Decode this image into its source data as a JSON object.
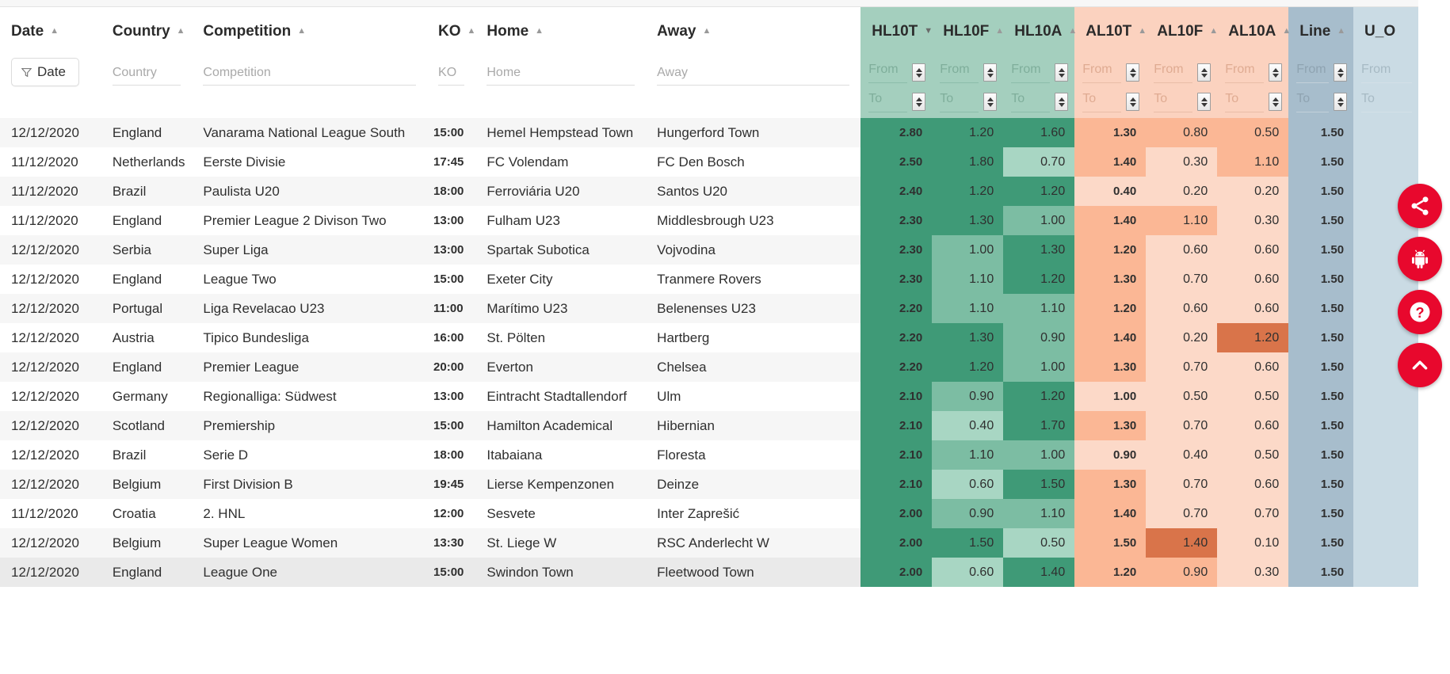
{
  "table": {
    "columns": [
      {
        "key": "date",
        "label": "Date",
        "sort": "asc",
        "group": "plain"
      },
      {
        "key": "country",
        "label": "Country",
        "sort": "asc",
        "group": "plain"
      },
      {
        "key": "comp",
        "label": "Competition",
        "sort": "asc",
        "group": "plain"
      },
      {
        "key": "ko",
        "label": "KO",
        "sort": "asc",
        "group": "plain"
      },
      {
        "key": "home",
        "label": "Home",
        "sort": "asc",
        "group": "plain"
      },
      {
        "key": "away",
        "label": "Away",
        "sort": "asc",
        "group": "plain"
      },
      {
        "key": "hl10t",
        "label": "HL10T",
        "sort": "desc",
        "group": "hl"
      },
      {
        "key": "hl10f",
        "label": "HL10F",
        "sort": "asc",
        "group": "hl"
      },
      {
        "key": "hl10a",
        "label": "HL10A",
        "sort": "asc",
        "group": "hl"
      },
      {
        "key": "al10t",
        "label": "AL10T",
        "sort": "asc",
        "group": "al"
      },
      {
        "key": "al10f",
        "label": "AL10F",
        "sort": "asc",
        "group": "al"
      },
      {
        "key": "al10a",
        "label": "AL10A",
        "sort": "asc",
        "group": "al"
      },
      {
        "key": "line",
        "label": "Line",
        "sort": "asc",
        "group": "line"
      },
      {
        "key": "uo",
        "label": "U_O",
        "sort": "asc",
        "group": "uo"
      }
    ],
    "filters": {
      "date_chip": "Date",
      "country": "Country",
      "competition": "Competition",
      "ko": "KO",
      "home": "Home",
      "away": "Away",
      "from": "From",
      "to": "To"
    },
    "rows": [
      {
        "date": "12/12/2020",
        "country": "England",
        "comp": "Vanarama National League South",
        "ko": "15:00",
        "home": "Hemel Hempstead Town",
        "away": "Hungerford Town",
        "hl10t": "2.80",
        "hl10f": "1.20",
        "hl10a": "1.60",
        "al10t": "1.30",
        "al10f": "0.80",
        "al10a": "0.50",
        "line": "1.50",
        "uo": "",
        "sh_t": 3,
        "sh_f": 3,
        "sh_a": 3,
        "sa_t": 3,
        "sa_f": 2,
        "sa_a": 2
      },
      {
        "date": "11/12/2020",
        "country": "Netherlands",
        "comp": "Eerste Divisie",
        "ko": "17:45",
        "home": "FC Volendam",
        "away": "FC Den Bosch",
        "hl10t": "2.50",
        "hl10f": "1.80",
        "hl10a": "0.70",
        "al10t": "1.40",
        "al10f": "0.30",
        "al10a": "1.10",
        "line": "1.50",
        "uo": "",
        "sh_t": 3,
        "sh_f": 3,
        "sh_a": 1,
        "sa_t": 3,
        "sa_f": 1,
        "sa_a": 3
      },
      {
        "date": "11/12/2020",
        "country": "Brazil",
        "comp": "Paulista U20",
        "ko": "18:00",
        "home": "Ferroviária U20",
        "away": "Santos U20",
        "hl10t": "2.40",
        "hl10f": "1.20",
        "hl10a": "1.20",
        "al10t": "0.40",
        "al10f": "0.20",
        "al10a": "0.20",
        "line": "1.50",
        "uo": "",
        "sh_t": 3,
        "sh_f": 3,
        "sh_a": 3,
        "sa_t": 1,
        "sa_f": 1,
        "sa_a": 1
      },
      {
        "date": "11/12/2020",
        "country": "England",
        "comp": "Premier League 2 Divison Two",
        "ko": "13:00",
        "home": "Fulham U23",
        "away": "Middlesbrough U23",
        "hl10t": "2.30",
        "hl10f": "1.30",
        "hl10a": "1.00",
        "al10t": "1.40",
        "al10f": "1.10",
        "al10a": "0.30",
        "line": "1.50",
        "uo": "",
        "sh_t": 3,
        "sh_f": 3,
        "sh_a": 2,
        "sa_t": 3,
        "sa_f": 3,
        "sa_a": 1
      },
      {
        "date": "12/12/2020",
        "country": "Serbia",
        "comp": "Super Liga",
        "ko": "13:00",
        "home": "Spartak Subotica",
        "away": "Vojvodina",
        "hl10t": "2.30",
        "hl10f": "1.00",
        "hl10a": "1.30",
        "al10t": "1.20",
        "al10f": "0.60",
        "al10a": "0.60",
        "line": "1.50",
        "uo": "",
        "sh_t": 3,
        "sh_f": 2,
        "sh_a": 3,
        "sa_t": 3,
        "sa_f": 1,
        "sa_a": 1
      },
      {
        "date": "12/12/2020",
        "country": "England",
        "comp": "League Two",
        "ko": "15:00",
        "home": "Exeter City",
        "away": "Tranmere Rovers",
        "hl10t": "2.30",
        "hl10f": "1.10",
        "hl10a": "1.20",
        "al10t": "1.30",
        "al10f": "0.70",
        "al10a": "0.60",
        "line": "1.50",
        "uo": "",
        "sh_t": 3,
        "sh_f": 2,
        "sh_a": 3,
        "sa_t": 3,
        "sa_f": 1,
        "sa_a": 1
      },
      {
        "date": "12/12/2020",
        "country": "Portugal",
        "comp": "Liga Revelacao U23",
        "ko": "11:00",
        "home": "Marítimo U23",
        "away": "Belenenses U23",
        "hl10t": "2.20",
        "hl10f": "1.10",
        "hl10a": "1.10",
        "al10t": "1.20",
        "al10f": "0.60",
        "al10a": "0.60",
        "line": "1.50",
        "uo": "",
        "sh_t": 3,
        "sh_f": 2,
        "sh_a": 2,
        "sa_t": 3,
        "sa_f": 1,
        "sa_a": 1
      },
      {
        "date": "12/12/2020",
        "country": "Austria",
        "comp": "Tipico Bundesliga",
        "ko": "16:00",
        "home": "St. Pölten",
        "away": "Hartberg",
        "hl10t": "2.20",
        "hl10f": "1.30",
        "hl10a": "0.90",
        "al10t": "1.40",
        "al10f": "0.20",
        "al10a": "1.20",
        "line": "1.50",
        "uo": "",
        "sh_t": 3,
        "sh_f": 3,
        "sh_a": 2,
        "sa_t": 3,
        "sa_f": 1,
        "sa_a": 4
      },
      {
        "date": "12/12/2020",
        "country": "England",
        "comp": "Premier League",
        "ko": "20:00",
        "home": "Everton",
        "away": "Chelsea",
        "hl10t": "2.20",
        "hl10f": "1.20",
        "hl10a": "1.00",
        "al10t": "1.30",
        "al10f": "0.70",
        "al10a": "0.60",
        "line": "1.50",
        "uo": "",
        "sh_t": 3,
        "sh_f": 3,
        "sh_a": 2,
        "sa_t": 3,
        "sa_f": 1,
        "sa_a": 1
      },
      {
        "date": "12/12/2020",
        "country": "Germany",
        "comp": "Regionalliga: Südwest",
        "ko": "13:00",
        "home": "Eintracht Stadtallendorf",
        "away": "Ulm",
        "hl10t": "2.10",
        "hl10f": "0.90",
        "hl10a": "1.20",
        "al10t": "1.00",
        "al10f": "0.50",
        "al10a": "0.50",
        "line": "1.50",
        "uo": "",
        "sh_t": 3,
        "sh_f": 2,
        "sh_a": 3,
        "sa_t": 1,
        "sa_f": 1,
        "sa_a": 1
      },
      {
        "date": "12/12/2020",
        "country": "Scotland",
        "comp": "Premiership",
        "ko": "15:00",
        "home": "Hamilton Academical",
        "away": "Hibernian",
        "hl10t": "2.10",
        "hl10f": "0.40",
        "hl10a": "1.70",
        "al10t": "1.30",
        "al10f": "0.70",
        "al10a": "0.60",
        "line": "1.50",
        "uo": "",
        "sh_t": 3,
        "sh_f": 1,
        "sh_a": 3,
        "sa_t": 3,
        "sa_f": 1,
        "sa_a": 1
      },
      {
        "date": "12/12/2020",
        "country": "Brazil",
        "comp": "Serie D",
        "ko": "18:00",
        "home": "Itabaiana",
        "away": "Floresta",
        "hl10t": "2.10",
        "hl10f": "1.10",
        "hl10a": "1.00",
        "al10t": "0.90",
        "al10f": "0.40",
        "al10a": "0.50",
        "line": "1.50",
        "uo": "",
        "sh_t": 3,
        "sh_f": 2,
        "sh_a": 2,
        "sa_t": 1,
        "sa_f": 1,
        "sa_a": 1
      },
      {
        "date": "12/12/2020",
        "country": "Belgium",
        "comp": "First Division B",
        "ko": "19:45",
        "home": "Lierse Kempenzonen",
        "away": "Deinze",
        "hl10t": "2.10",
        "hl10f": "0.60",
        "hl10a": "1.50",
        "al10t": "1.30",
        "al10f": "0.70",
        "al10a": "0.60",
        "line": "1.50",
        "uo": "",
        "sh_t": 3,
        "sh_f": 1,
        "sh_a": 3,
        "sa_t": 3,
        "sa_f": 1,
        "sa_a": 1
      },
      {
        "date": "11/12/2020",
        "country": "Croatia",
        "comp": "2. HNL",
        "ko": "12:00",
        "home": "Sesvete",
        "away": "Inter Zaprešić",
        "hl10t": "2.00",
        "hl10f": "0.90",
        "hl10a": "1.10",
        "al10t": "1.40",
        "al10f": "0.70",
        "al10a": "0.70",
        "line": "1.50",
        "uo": "",
        "sh_t": 3,
        "sh_f": 2,
        "sh_a": 2,
        "sa_t": 3,
        "sa_f": 1,
        "sa_a": 1
      },
      {
        "date": "12/12/2020",
        "country": "Belgium",
        "comp": "Super League Women",
        "ko": "13:30",
        "home": "St. Liege W",
        "away": "RSC Anderlecht W",
        "hl10t": "2.00",
        "hl10f": "1.50",
        "hl10a": "0.50",
        "al10t": "1.50",
        "al10f": "1.40",
        "al10a": "0.10",
        "line": "1.50",
        "uo": "",
        "sh_t": 3,
        "sh_f": 3,
        "sh_a": 1,
        "sa_t": 3,
        "sa_f": 4,
        "sa_a": 1
      },
      {
        "date": "12/12/2020",
        "country": "England",
        "comp": "League One",
        "ko": "15:00",
        "home": "Swindon Town",
        "away": "Fleetwood Town",
        "hl10t": "2.00",
        "hl10f": "0.60",
        "hl10a": "1.40",
        "al10t": "1.20",
        "al10f": "0.90",
        "al10a": "0.30",
        "line": "1.50",
        "uo": "",
        "sh_t": 3,
        "sh_f": 1,
        "sh_a": 3,
        "sa_t": 3,
        "sa_f": 2,
        "sa_a": 1
      }
    ]
  },
  "fabs": [
    {
      "name": "share-fab",
      "icon": "share-icon"
    },
    {
      "name": "android-fab",
      "icon": "android-icon"
    },
    {
      "name": "help-fab",
      "icon": "question-mark-icon"
    },
    {
      "name": "scroll-top-fab",
      "icon": "chevron-up-icon"
    }
  ],
  "colors": {
    "hl_header": "#a4cfbe",
    "al_header": "#fbd2bf",
    "line_header": "#a7bdcc",
    "uo_header": "#cadbe4",
    "green_dark": "#3f9a77",
    "green_mid": "#7cbda3",
    "green_light": "#a8d6c3",
    "orange_dark": "#d9744a",
    "orange_mid": "#fbb795",
    "orange_light": "#fcd9c8",
    "line_cell": "#a7bdcc",
    "uo_cell": "#cadbe4",
    "fab": "#e8082d"
  }
}
